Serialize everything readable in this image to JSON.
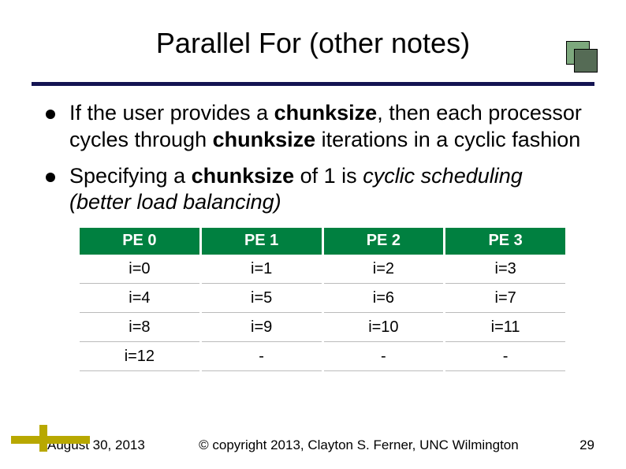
{
  "title": "Parallel For (other notes)",
  "bullets": [
    {
      "parts": [
        {
          "t": "If the user provides a ",
          "b": false,
          "i": false
        },
        {
          "t": "chunksize",
          "b": true,
          "i": false
        },
        {
          "t": ", then each processor cycles through ",
          "b": false,
          "i": false
        },
        {
          "t": "chunksize",
          "b": true,
          "i": false
        },
        {
          "t": " iterations in a cyclic fashion",
          "b": false,
          "i": false
        }
      ]
    },
    {
      "parts": [
        {
          "t": "Specifying a ",
          "b": false,
          "i": false
        },
        {
          "t": "chunksize",
          "b": true,
          "i": false
        },
        {
          "t": " of 1 is ",
          "b": false,
          "i": false
        },
        {
          "t": "cyclic scheduling (better load balancing)",
          "b": false,
          "i": true
        }
      ]
    }
  ],
  "chart_data": {
    "type": "table",
    "headers": [
      "PE 0",
      "PE 1",
      "PE 2",
      "PE 3"
    ],
    "rows": [
      [
        "i=0",
        "i=1",
        "i=2",
        "i=3"
      ],
      [
        "i=4",
        "i=5",
        "i=6",
        "i=7"
      ],
      [
        "i=8",
        "i=9",
        "i=10",
        "i=11"
      ],
      [
        "i=12",
        "-",
        "-",
        "-"
      ]
    ]
  },
  "footer": {
    "date": "August 30, 2013",
    "copyright": "© copyright 2013, Clayton S. Ferner, UNC Wilmington",
    "page": "29"
  }
}
